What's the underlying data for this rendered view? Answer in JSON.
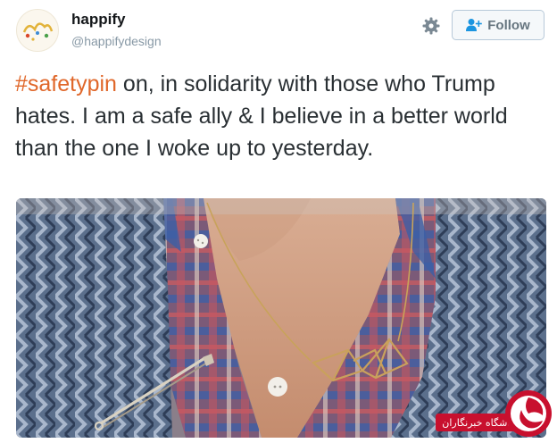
{
  "author": {
    "name": "happify",
    "handle": "@happifydesign"
  },
  "follow_label": "Follow",
  "tweet": {
    "hashtag": "#safetypin",
    "body": " on, in solidarity with those who Trump hates. I am a safe ally & I believe in a better world than the one I woke up to yesterday."
  },
  "watermark": "باشگاه خبرنگاران",
  "colors": {
    "hashtag": "#e0672a",
    "text": "#292f33",
    "muted": "#8899a6",
    "watermark": "#c8102e"
  },
  "icons": [
    "gear-icon",
    "add-user-icon"
  ]
}
